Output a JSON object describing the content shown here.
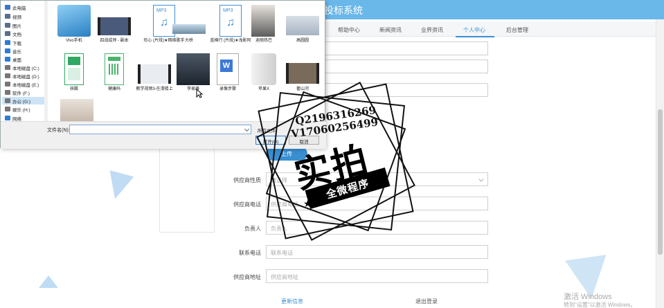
{
  "app": {
    "title": "投标系统",
    "nav_items": [
      "帮助中心",
      "新闻资讯",
      "业界资讯",
      "个人中心",
      "后台管理"
    ],
    "active_nav": "个人中心",
    "upload_label": "上传",
    "form": [
      {
        "label": "供应商性质",
        "placeholder": "请选择",
        "type": "select"
      },
      {
        "label": "供应商电话",
        "placeholder": "供应商电话",
        "type": "text"
      },
      {
        "label": "负责人",
        "placeholder": "负责人",
        "type": "text"
      },
      {
        "label": "联系电话",
        "placeholder": "联系电话",
        "type": "text"
      },
      {
        "label": "供应商地址",
        "placeholder": "供应商地址",
        "type": "text"
      }
    ],
    "bottom_tabs": [
      "更新信息",
      "退出登录"
    ],
    "windows_watermark": {
      "line1": "激活 Windows",
      "line2": "转到\"设置\"以激活 Windows。"
    },
    "accent_color": "#3a8fd1",
    "header_color": "#6ab7ea"
  },
  "dialog": {
    "tree": [
      {
        "label": "此电脑",
        "icon": "computer-icon",
        "color": "#3b78c4"
      },
      {
        "label": "视频",
        "icon": "video-folder-icon",
        "color": "#5b6f8c"
      },
      {
        "label": "图片",
        "icon": "pictures-folder-icon",
        "color": "#5b6f8c"
      },
      {
        "label": "文档",
        "icon": "documents-folder-icon",
        "color": "#5b6f8c"
      },
      {
        "label": "下载",
        "icon": "download-icon",
        "color": "#2e7bd6"
      },
      {
        "label": "音乐",
        "icon": "music-icon",
        "color": "#2e7bd6"
      },
      {
        "label": "桌面",
        "icon": "desktop-icon",
        "color": "#2e7bd6"
      },
      {
        "label": "本地磁盘 (C:)",
        "icon": "drive-icon",
        "color": "#777777"
      },
      {
        "label": "本地磁盘 (D:)",
        "icon": "drive-icon",
        "color": "#777777"
      },
      {
        "label": "本地磁盘 (E:)",
        "icon": "drive-icon",
        "color": "#777777"
      },
      {
        "label": "软件 (F:)",
        "icon": "drive-icon",
        "color": "#777777"
      },
      {
        "label": "办公 (G:)",
        "icon": "drive-icon",
        "color": "#777777",
        "selected": true
      },
      {
        "label": "娱乐 (H:)",
        "icon": "drive-icon",
        "color": "#777777"
      },
      {
        "label": "网络",
        "icon": "network-icon",
        "color": "#2e7bd6"
      }
    ],
    "files": [
      {
        "label": "Vivo手机",
        "kind": "photo",
        "color": "#4aa0d8"
      },
      {
        "label": "四战成师 - 副本",
        "kind": "photo",
        "color": "#4a5a7a"
      },
      {
        "label": "形心 (片段)★网络歌手",
        "kind": "mp3",
        "color": "#3c8fd6"
      },
      {
        "label": "大桥",
        "kind": "photo",
        "color": "#8fb3cc"
      },
      {
        "label": "蓝棉行 (片段)★浅影阿",
        "kind": "mp3",
        "color": "#3c8fd6"
      },
      {
        "label": "迪丽热巴",
        "kind": "photo",
        "color": "#6b6b6b"
      },
      {
        "label": "高圆圆",
        "kind": "photo",
        "color": "#b9c4cf"
      },
      {
        "label": "核酸",
        "kind": "photo",
        "color": "#2fa862"
      },
      {
        "label": "健康码",
        "kind": "photo",
        "color": "#48b36b"
      },
      {
        "label": "教学视频3-在滑楼上",
        "kind": "photo",
        "color": "#9aa6b2"
      },
      {
        "label": "李易峰",
        "kind": "photo",
        "color": "#2b3440"
      },
      {
        "label": "录像步骤",
        "kind": "word",
        "color": "#3d79d6"
      },
      {
        "label": "苹果X",
        "kind": "photo",
        "color": "#d9d9d9"
      },
      {
        "label": "瞿山河",
        "kind": "photo",
        "color": "#7a6a5a"
      },
      {
        "label": "",
        "kind": "photo",
        "color": "#c9b8a8"
      }
    ],
    "filename_label": "文件名(N):",
    "filetype_label": "所有文件",
    "open_label": "打开(O)",
    "cancel_label": "取消"
  },
  "stamp": {
    "line1": "Q2196316269",
    "line2": "V17060256499",
    "main": "实拍",
    "banner": "全微程序"
  }
}
